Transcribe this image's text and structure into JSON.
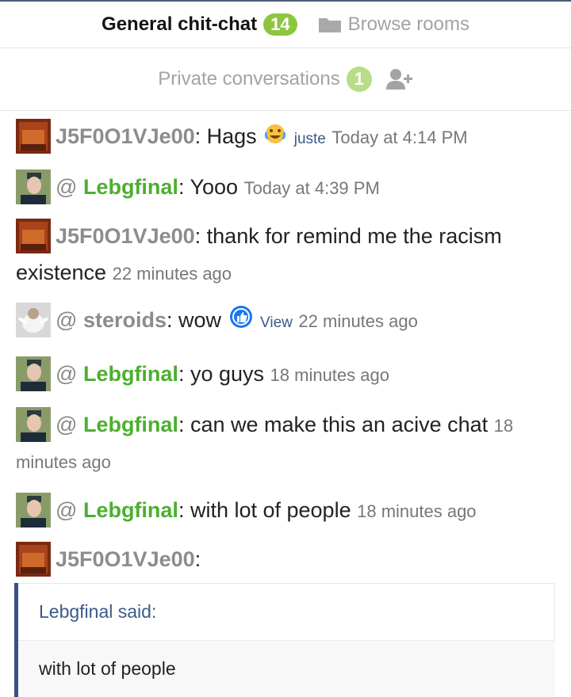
{
  "tabs": {
    "general": {
      "label": "General chit-chat",
      "count": "14"
    },
    "browse": {
      "label": "Browse rooms"
    },
    "private": {
      "label": "Private conversations",
      "count": "1"
    }
  },
  "messages": [
    {
      "user": "J5F0O1VJe00",
      "text": "Hags",
      "link": "juste",
      "time": "Today at 4:14 PM"
    },
    {
      "at": "@",
      "user": "Lebgfinal",
      "text": "Yooo",
      "time": "Today at 4:39 PM"
    },
    {
      "user": "J5F0O1VJe00",
      "text": "thank for remind me the racism existence",
      "time": "22 minutes ago"
    },
    {
      "at": "@",
      "user": "steroids",
      "text": "wow",
      "link": "View",
      "time": "22 minutes ago"
    },
    {
      "at": "@",
      "user": "Lebgfinal",
      "text": "yo guys",
      "time": "18 minutes ago"
    },
    {
      "at": "@",
      "user": "Lebgfinal",
      "text": "can we make this an acive chat",
      "time": "18 minutes ago"
    },
    {
      "at": "@",
      "user": "Lebgfinal",
      "text": "with lot of people",
      "time": "18 minutes ago"
    },
    {
      "user": "J5F0O1VJe00",
      "text": ""
    }
  ],
  "quote": {
    "author": "Lebgfinal said:",
    "text": "with lot of people"
  },
  "colors": {
    "badge": "#8cc63f",
    "username_green": "#4caf2f",
    "username_gray": "#8c8c8c",
    "quote_border": "#3b4f86"
  }
}
